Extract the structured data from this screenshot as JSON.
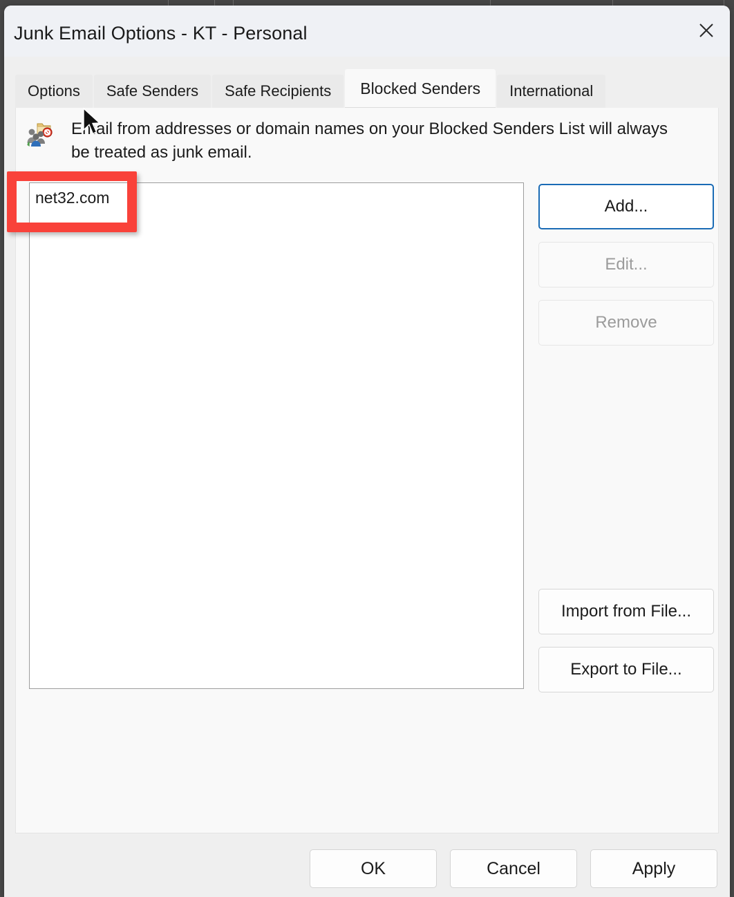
{
  "window": {
    "title": "Junk Email Options - KT - Personal",
    "close_icon": "close-icon"
  },
  "tabs": [
    {
      "label": "Options",
      "active": false
    },
    {
      "label": "Safe Senders",
      "active": false
    },
    {
      "label": "Safe Recipients",
      "active": false
    },
    {
      "label": "Blocked Senders",
      "active": true
    },
    {
      "label": "International",
      "active": false
    }
  ],
  "panel": {
    "icon": "blocked-senders-icon",
    "description": "Email from addresses or domain names on your Blocked Senders List will always be treated as junk email."
  },
  "senders_list": {
    "items": [
      "net32.com"
    ]
  },
  "side_buttons": {
    "add": "Add...",
    "edit": "Edit...",
    "remove": "Remove",
    "import": "Import from File...",
    "export": "Export to File..."
  },
  "footer_buttons": {
    "ok": "OK",
    "cancel": "Cancel",
    "apply": "Apply"
  },
  "annotation": {
    "color": "#f9423a",
    "target": "net32.com"
  },
  "colors": {
    "titlebar": "#eff1f5",
    "panel": "#f9f9f9",
    "footer": "#efefef",
    "focus_border": "#1a6bb5",
    "disabled_text": "#9b9b9b",
    "accent_strip": "#c77fd6"
  }
}
